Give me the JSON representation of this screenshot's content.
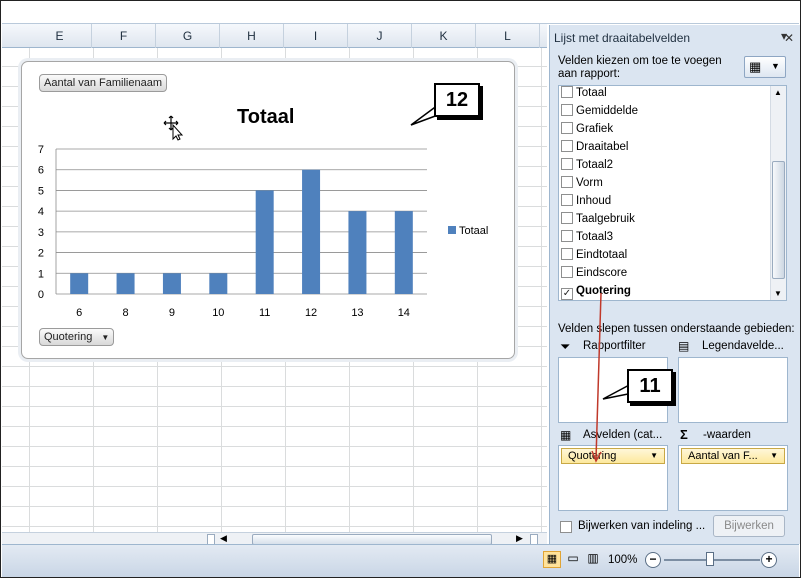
{
  "columns": [
    "E",
    "F",
    "G",
    "H",
    "I",
    "J",
    "K",
    "L"
  ],
  "chart": {
    "pivot_value_button": "Aantal van Familienaam",
    "axis_field_button": "Quotering",
    "dropdown_glyph": "▼"
  },
  "chart_data": {
    "type": "bar",
    "title": "Totaal",
    "categories": [
      "6",
      "8",
      "9",
      "10",
      "11",
      "12",
      "13",
      "14"
    ],
    "series": [
      {
        "name": "Totaal",
        "values": [
          1,
          1,
          1,
          1,
          5,
          6,
          4,
          4
        ],
        "color": "#4f81bd"
      }
    ],
    "ylim": [
      0,
      7
    ],
    "yticks": [
      "0",
      "1",
      "2",
      "3",
      "4",
      "5",
      "6",
      "7"
    ],
    "grid": true,
    "legend": "right"
  },
  "callouts": {
    "chart": "12",
    "panel": "11"
  },
  "panel": {
    "title": "Lijst met draaitabelvelden",
    "choose_label": "Velden kiezen om toe te voegen aan rapport:",
    "fields": [
      {
        "label": "Totaal",
        "checked": false
      },
      {
        "label": "Gemiddelde",
        "checked": false
      },
      {
        "label": "Grafiek",
        "checked": false
      },
      {
        "label": "Draaitabel",
        "checked": false
      },
      {
        "label": "Totaal2",
        "checked": false
      },
      {
        "label": "Vorm",
        "checked": false
      },
      {
        "label": "Inhoud",
        "checked": false
      },
      {
        "label": "Taalgebruik",
        "checked": false
      },
      {
        "label": "Totaal3",
        "checked": false
      },
      {
        "label": "Eindtotaal",
        "checked": false
      },
      {
        "label": "Eindscore",
        "checked": false
      },
      {
        "label": "Quotering",
        "checked": true
      }
    ],
    "drag_label": "Velden slepen tussen onderstaande gebieden:",
    "report_filter": "Rapportfilter",
    "legend_fields": "Legendavelde...",
    "axis_fields": "Asvelden (cat...",
    "values": "-waarden",
    "axis_chip": "Quotering",
    "values_chip": "Aantal van F...",
    "defer_label": "Bijwerken van indeling ...",
    "update_button": "Bijwerken",
    "sigma": "Σ",
    "checkmark": "✓"
  },
  "status": {
    "zoom": "100%"
  }
}
